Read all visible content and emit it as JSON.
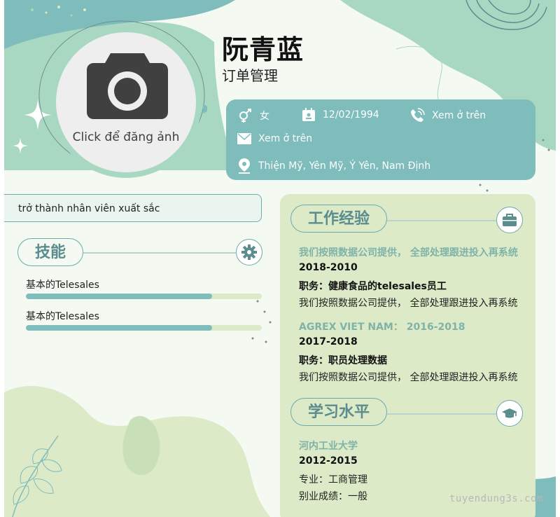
{
  "profile": {
    "name": "阮青蓝",
    "position": "订单管理",
    "photo_upload_text": "Click để đăng ảnh"
  },
  "info": {
    "gender": "女",
    "birthday": "12/02/1994",
    "phone": "Xem ở trên",
    "email": "Xem ở trên",
    "address": "Thiện Mỹ, Yên Mỹ, Ý Yên, Nam Định"
  },
  "objective": {
    "text": "trở thành nhân viên xuất sắc"
  },
  "skills": {
    "heading": "技能",
    "items": [
      {
        "name": "基本的Telesales",
        "level": 0.79
      },
      {
        "name": "基本的Telesales",
        "level": 0.79
      }
    ]
  },
  "experience": {
    "heading": "工作经验",
    "items": [
      {
        "company": "我们按照数据公司提供， 全部处理跟进投入再系统",
        "period": "2018-2010",
        "role": "职务：健康食品的telesales员工",
        "description": "我们按照数据公司提供， 全部处理跟进投入再系统"
      },
      {
        "company": "AGREX VIET NAM： 2016-2018",
        "period": "2017-2018",
        "role": "职务：职员处理数据",
        "description": "我们按照数据公司提供， 全部处理跟进投入再系统"
      }
    ]
  },
  "education": {
    "heading": "学习水平",
    "school": "河内工业大学",
    "period": "2012-2015",
    "major": "专业：工商管理",
    "grade": "别业成绩：一般"
  },
  "watermark": "tuyendung3s.com",
  "colors": {
    "teal": "#7fbcbc",
    "mint": "#a8d8c2",
    "sage": "#dceac7",
    "heading_text": "#5b8c8e",
    "background": "#f4f9f2"
  },
  "icons": [
    "camera-icon",
    "gender-icon",
    "calendar-icon",
    "phone-icon",
    "mail-icon",
    "location-icon",
    "gear-icon",
    "briefcase-icon",
    "graduation-cap-icon",
    "sparkle-icon",
    "leaf-icon"
  ]
}
